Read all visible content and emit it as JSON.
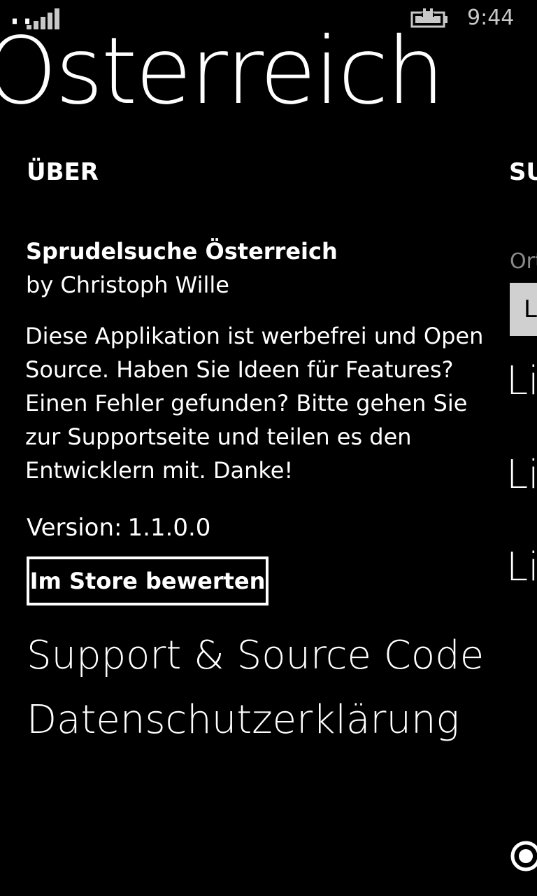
{
  "status_bar": {
    "signal_icon": "signal-strength-icon",
    "battery_icon": "battery-charging-icon",
    "time": "9:44"
  },
  "pivot": {
    "title": "Österreich",
    "headers": [
      {
        "label": "ÜBER"
      },
      {
        "label": "SU"
      }
    ]
  },
  "about": {
    "app_name": "Sprudelsuche Österreich",
    "author": "by Christoph Wille",
    "description": "Diese Applikation ist werbefrei und Open Source. Haben Sie Ideen für Features? Einen Fehler gefunden? Bitte gehen Sie zur Supportseite und teilen es den Entwicklern mit. Danke!",
    "version_label": "Version:",
    "version_value": "1.1.0.0",
    "rate_button": "Im Store bewerten",
    "support_link": "Support & Source Code",
    "privacy_link": "Datenschutzerklärung"
  },
  "peek": {
    "label": "Ort",
    "box_text": "L",
    "items": [
      "Li",
      "Li",
      "Li"
    ],
    "circle_icon": "radio-circle-icon"
  },
  "colors": {
    "background": "#000000",
    "foreground": "#ffffff",
    "secondary": "#8a8a8a",
    "input_bg": "#d0d0d0"
  }
}
